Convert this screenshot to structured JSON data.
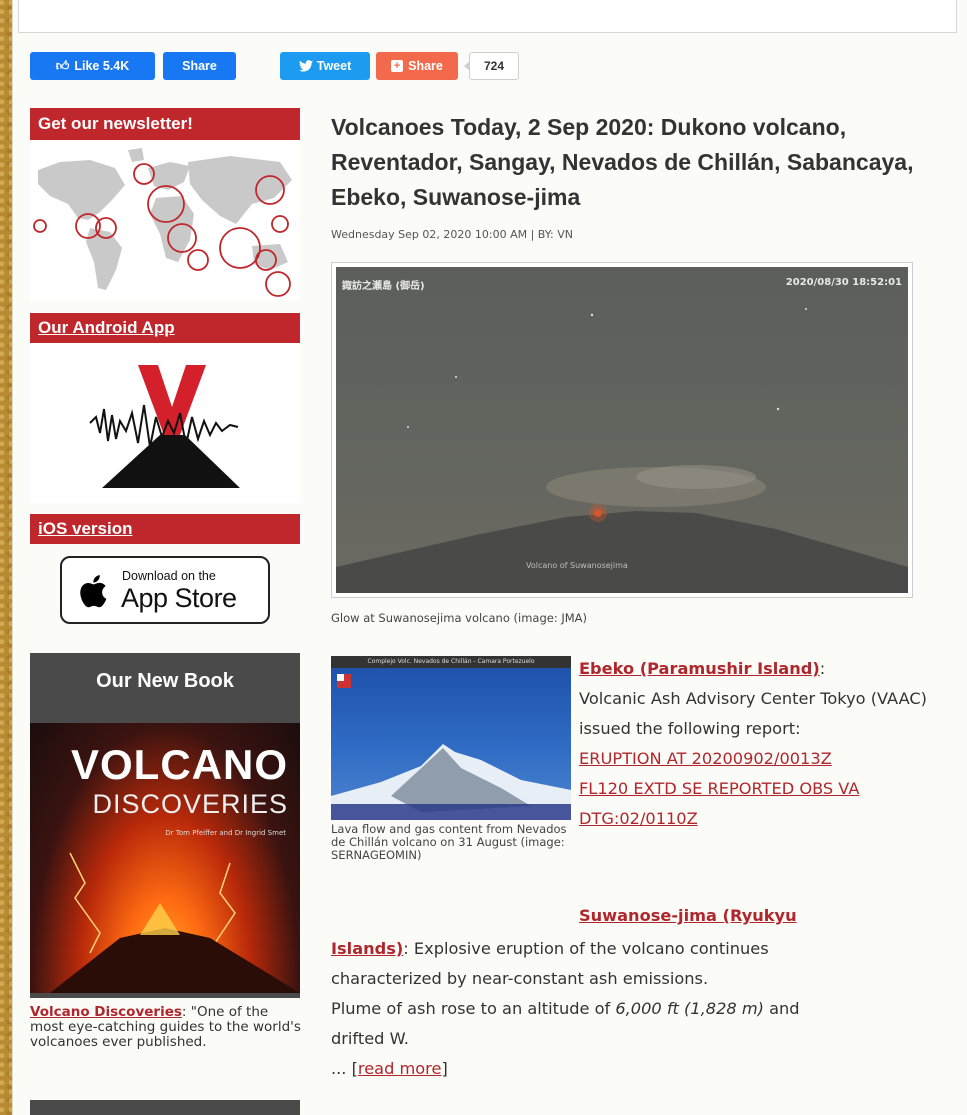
{
  "social": {
    "like_label": "Like 5.4K",
    "fb_share_label": "Share",
    "tweet_label": "Tweet",
    "share_label": "Share",
    "share_count": "724"
  },
  "sidebar": {
    "newsletter_heading": "Get our newsletter!",
    "android_heading": "Our Android App",
    "ios_heading": "iOS version",
    "appstore_small": "Download on the",
    "appstore_big": "App Store",
    "book_heading": "Our New Book",
    "book_cover_title": "VOLCANO",
    "book_cover_subtitle": "DISCOVERIES",
    "book_cover_authors": "Dr Tom Pfeiffer and Dr Ingrid Smet",
    "book_link": "Volcano Discoveries",
    "book_quote": ": \"One of the most eye-catching guides to the world's volcanoes ever published."
  },
  "article": {
    "title": "Volcanoes Today, 2 Sep 2020: Dukono volcano, Reventador, Sangay, Nevados de Chillán, Sabancaya, Ebeko, Suwanose-jima",
    "meta": "Wednesday Sep 02, 2020 10:00 AM | BY: VN",
    "cam_label_left": "諏訪之瀬島 (御岳)",
    "cam_label_right": "2020/08/30 18:52:01",
    "cam_watermark": "Volcano of Suwanosejima",
    "main_caption": "Glow at Suwanosejima volcano (image: JMA)",
    "small_cam_label": "Complejo Volc. Nevados de Chillán - Camara Portezuelo",
    "small_caption": "Lava flow and gas content from Nevados de Chillán volcano on 31 August (image: SERNAGEOMIN)",
    "ebeko_heading": "Ebeko (Paramushir Island)",
    "ebeko_text": "Volcanic Ash Advisory Center Tokyo (VAAC) issued the following report:",
    "ebeko_report1": "ERUPTION AT 20200902/0013Z",
    "ebeko_report2": "FL120 EXTD SE REPORTED OBS VA",
    "ebeko_report3": "DTG:02/0110Z",
    "suwa_heading_line1": "Suwanose-jima (Ryukyu",
    "suwa_heading_line2": "Islands)",
    "suwa_text1": ": Explosive eruption of the volcano continues",
    "suwa_text2": "characterized by near-constant ash emissions.",
    "plume_prefix": "Plume of ash rose to an altitude of ",
    "plume_alt": "6,000 ft (1,828 m)",
    "plume_suffix": " and",
    "plume_line2": "drifted W.",
    "read_more_prefix": "... [",
    "read_more": "read more",
    "read_more_suffix": "]"
  },
  "colors": {
    "brand_red": "#c0272d",
    "link_red": "#b0262c",
    "facebook": "#1877f2",
    "twitter": "#1d9bf0",
    "share_orange": "#f26a4b"
  }
}
